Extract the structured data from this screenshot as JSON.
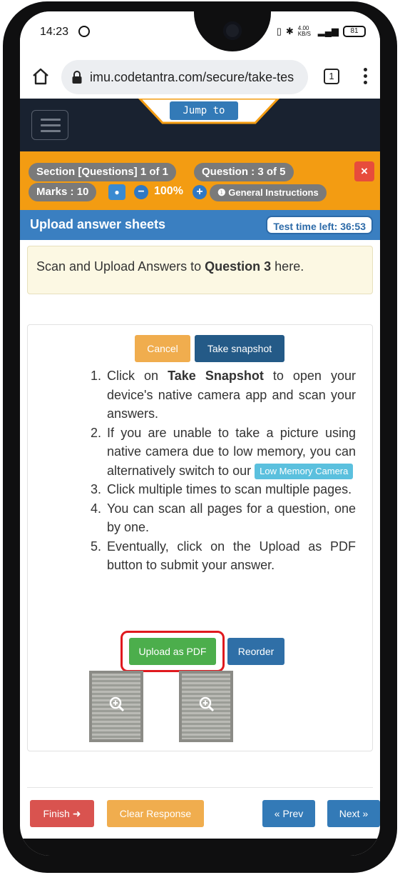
{
  "status_bar": {
    "time": "14:23",
    "network_speed": "4.00 KB/S",
    "battery": "81"
  },
  "browser": {
    "url": "imu.codetantra.com/secure/take-tes",
    "tab_count": "1"
  },
  "nav": {
    "jump_label": "Jump to"
  },
  "header": {
    "section": "Section [Questions] 1 of 1",
    "question": "Question : 3 of 5",
    "marks": "Marks : 10",
    "zoom": "100%",
    "instructions": "General Instructions",
    "close": "×"
  },
  "title_bar": {
    "title": "Upload answer sheets",
    "timer": "Test time left: 36:53"
  },
  "info": {
    "prefix": "Scan and Upload Answers to ",
    "bold": "Question 3",
    "suffix": " here."
  },
  "panel": {
    "cancel": "Cancel",
    "snapshot": "Take snapshot",
    "steps": {
      "s1_prefix": "Click on ",
      "s1_bold": "Take Snapshot",
      "s1_suffix": " to open your device's native camera app and scan your answers.",
      "s2": "If you are unable to take a picture using native camera due to low memory, you can alternatively switch to our",
      "s2_button": "Low Memory Camera",
      "s3": "Click multiple times to scan multiple pages.",
      "s4": "You can scan all pages for a question, one by one.",
      "s5": "Eventually, click on the Upload as PDF button to submit your answer."
    },
    "upload_pdf": "Upload as PDF",
    "reorder": "Reorder"
  },
  "footer": {
    "finish": "Finish",
    "clear": "Clear Response",
    "prev": "« Prev",
    "next": "Next »"
  }
}
